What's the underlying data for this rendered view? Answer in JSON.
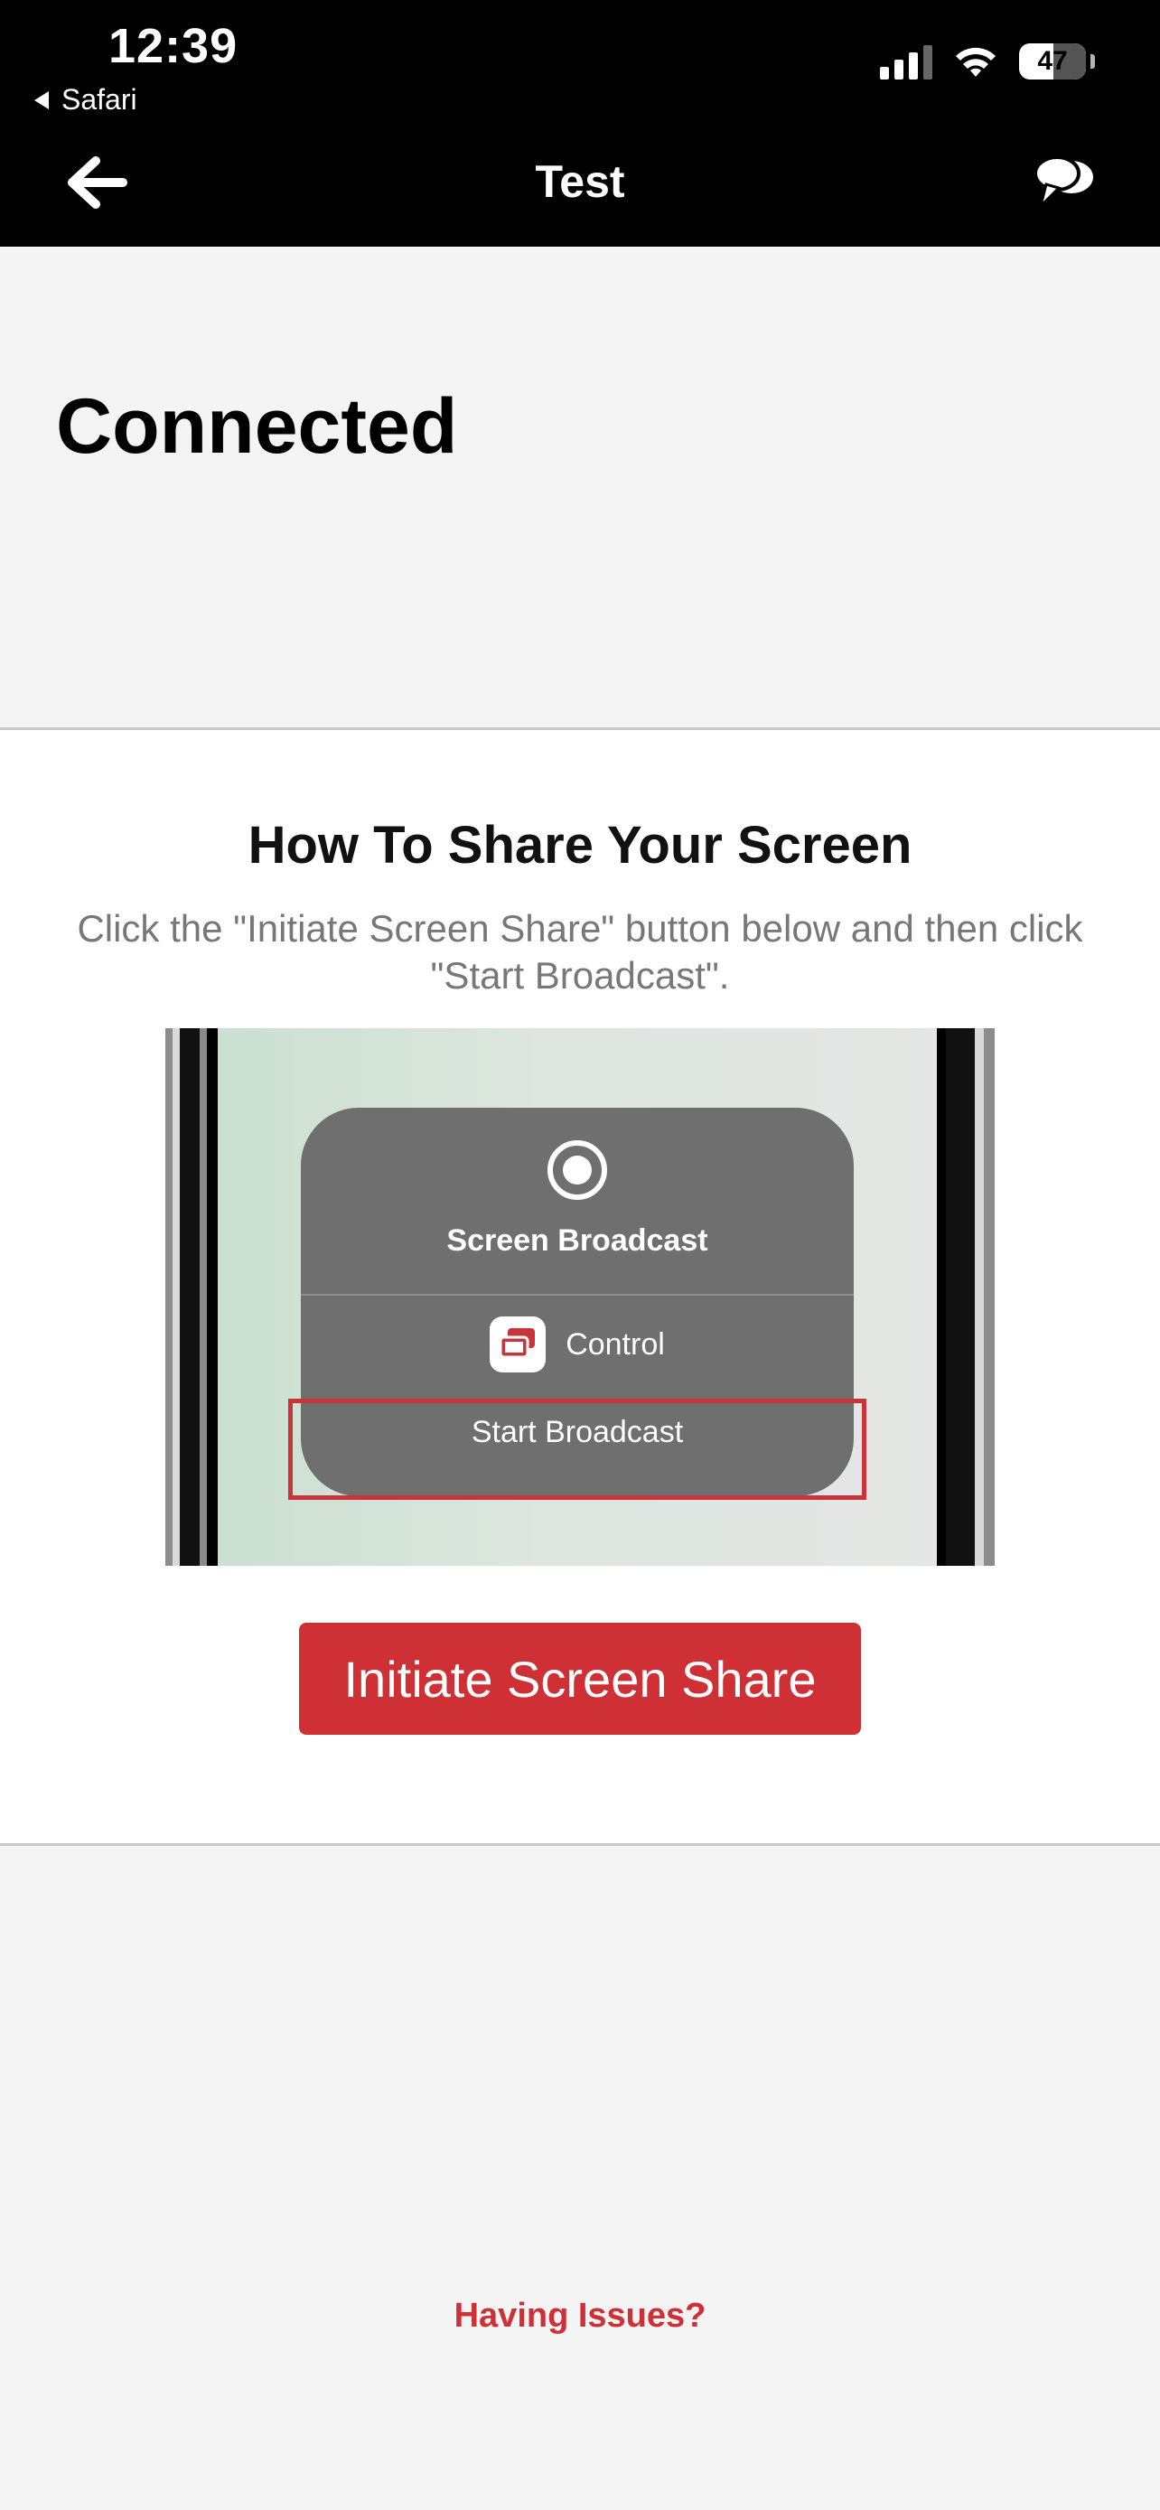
{
  "status_bar": {
    "time": "12:39",
    "back_app": "Safari",
    "battery": "47"
  },
  "nav": {
    "title": "Test",
    "back_icon": "arrow-left-icon",
    "chat_icon": "speech-bubbles-icon"
  },
  "connection": {
    "status": "Connected"
  },
  "howto": {
    "title": "How To Share Your Screen",
    "description": "Click the \"Initiate Screen Share\" button below and then click \"Start Broadcast\".",
    "illustration": {
      "panel_title": "Screen Broadcast",
      "app_label": "Control",
      "start_label": "Start Broadcast"
    },
    "button_label": "Initiate Screen Share"
  },
  "footer": {
    "help_link": "Having Issues?"
  },
  "colors": {
    "accent": "#cf3035",
    "header_bg": "#000000",
    "page_bg": "#f4f4f4"
  }
}
